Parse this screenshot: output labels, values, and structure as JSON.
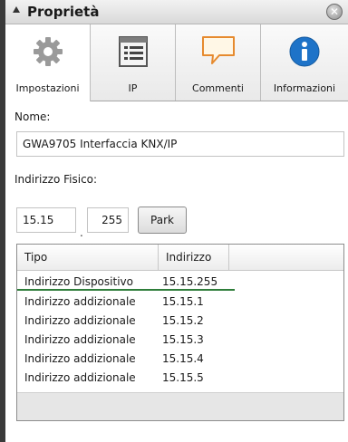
{
  "panel": {
    "title": "Proprietà"
  },
  "tabs": [
    {
      "label": "Impostazioni",
      "icon": "gear-icon",
      "active": true
    },
    {
      "label": "IP",
      "icon": "list-icon",
      "active": false
    },
    {
      "label": "Commenti",
      "icon": "comment-icon",
      "active": false
    },
    {
      "label": "Informazioni",
      "icon": "info-icon",
      "active": false
    }
  ],
  "form": {
    "name_label": "Nome:",
    "name_value": "GWA9705 Interfaccia KNX/IP",
    "address_label": "Indirizzo Fisico:",
    "address_part1": "15.15",
    "address_separator": ".",
    "address_part2": "255",
    "park_label": "Park"
  },
  "grid": {
    "columns": [
      "Tipo",
      "Indirizzo"
    ],
    "rows": [
      {
        "tipo": "Indirizzo Dispositivo",
        "indirizzo": "15.15.255"
      },
      {
        "tipo": "Indirizzo addizionale",
        "indirizzo": "15.15.1"
      },
      {
        "tipo": "Indirizzo addizionale",
        "indirizzo": "15.15.2"
      },
      {
        "tipo": "Indirizzo addizionale",
        "indirizzo": "15.15.3"
      },
      {
        "tipo": "Indirizzo addizionale",
        "indirizzo": "15.15.4"
      },
      {
        "tipo": "Indirizzo addizionale",
        "indirizzo": "15.15.5"
      }
    ]
  },
  "colors": {
    "selection_underline": "#2e7d3a",
    "info_blue": "#1e73c8"
  }
}
